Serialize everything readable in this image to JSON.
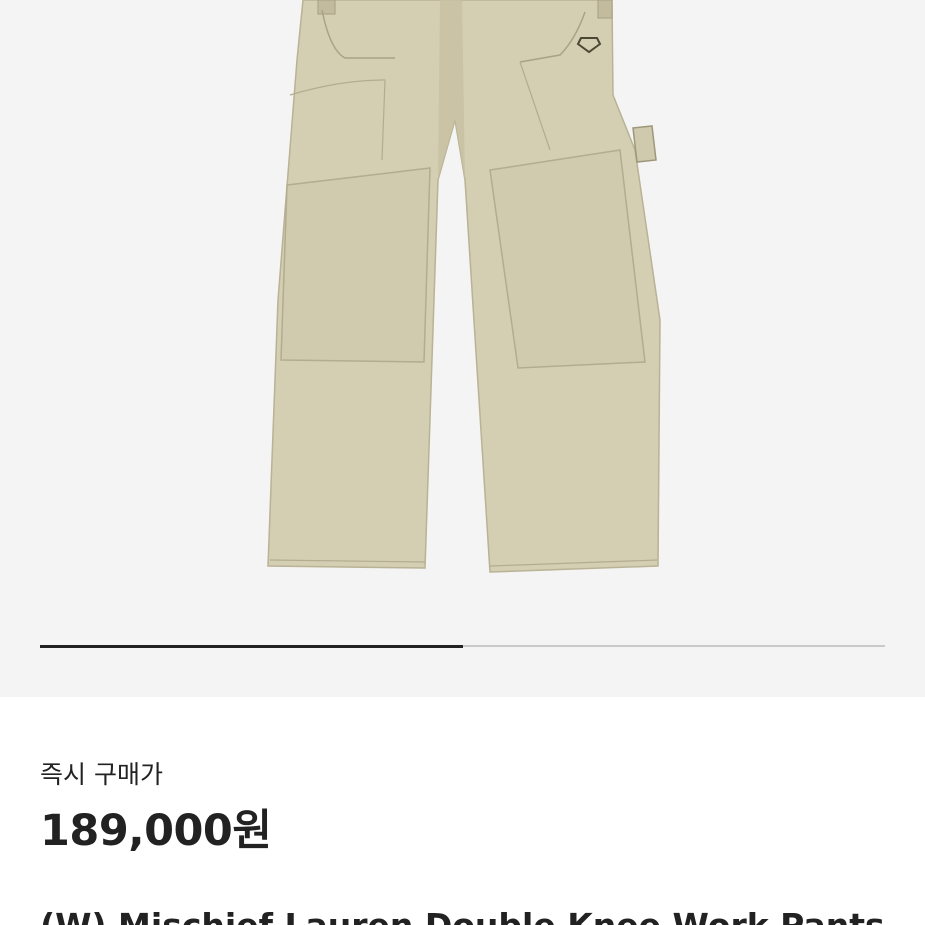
{
  "gallery": {
    "image_name": "beige-double-knee-work-pants",
    "progress": 0.5,
    "colors": {
      "background": "#f4f4f4",
      "fabric": "#d3cdb2",
      "progress_fill": "#222222",
      "progress_track": "#c9c9c9"
    }
  },
  "product": {
    "price_label": "즉시 구매가",
    "price_value": "189,000원",
    "title_partial": "(W) Mischief Lauren Double Knee Work Pants"
  }
}
